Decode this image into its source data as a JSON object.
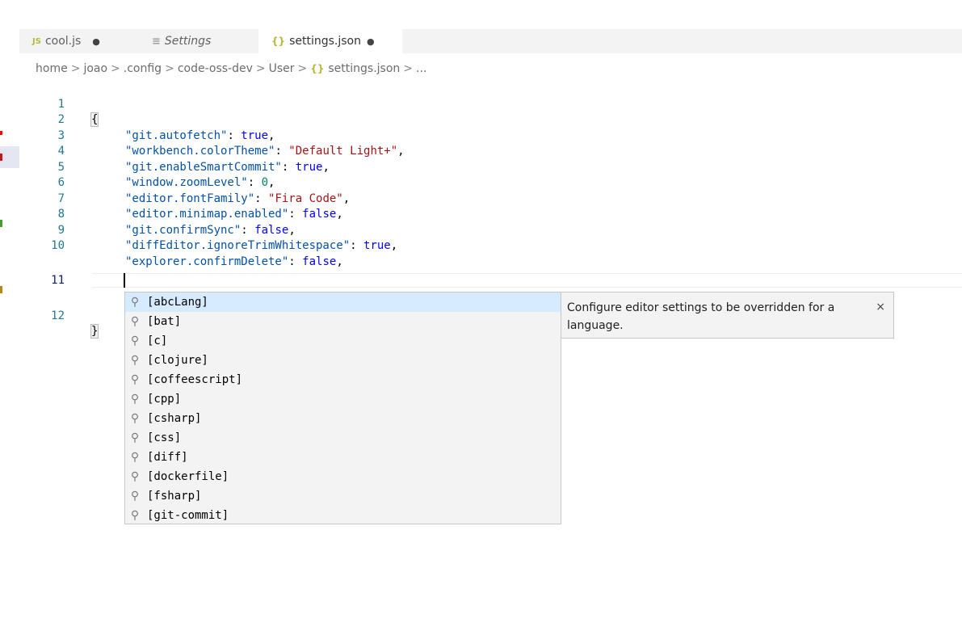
{
  "colors": {
    "left_marks": [
      "#e51400",
      "#c41919",
      "#4b9a2e",
      "#b5861c"
    ],
    "selection_bg": "#d6ebff",
    "string": "#a31515",
    "keyword": "#0000ff",
    "number": "#098658",
    "property": "#0451a5",
    "line_number": "#237893"
  },
  "tabs": [
    {
      "icon": "JS",
      "label": "cool.js",
      "dirty": "●",
      "active": false
    },
    {
      "icon": "≡",
      "label": "Settings",
      "dirty": "",
      "active": false,
      "italic": true
    },
    {
      "icon": "{}",
      "label": "settings.json",
      "dirty": "●",
      "active": true
    }
  ],
  "breadcrumb": {
    "parts": [
      "home",
      "joao",
      ".config",
      "code-oss-dev",
      "User"
    ],
    "file_icon": "{}",
    "file": "settings.json",
    "tail": "...",
    "separator": ">"
  },
  "editor": {
    "line_numbers": [
      "1",
      "2",
      "3",
      "4",
      "5",
      "6",
      "7",
      "8",
      "9",
      "10",
      "11",
      "12"
    ],
    "current_line": "11",
    "open_brace": "{",
    "close_brace": "}",
    "settings": [
      {
        "key": "\"git.autofetch\"",
        "value": "true",
        "type": "kw"
      },
      {
        "key": "\"workbench.colorTheme\"",
        "value": "\"Default Light+\"",
        "type": "str"
      },
      {
        "key": "\"git.enableSmartCommit\"",
        "value": "true",
        "type": "kw"
      },
      {
        "key": "\"window.zoomLevel\"",
        "value": "0",
        "type": "num"
      },
      {
        "key": "\"editor.fontFamily\"",
        "value": "\"Fira Code\"",
        "type": "str"
      },
      {
        "key": "\"editor.minimap.enabled\"",
        "value": "false",
        "type": "kw"
      },
      {
        "key": "\"git.confirmSync\"",
        "value": "false",
        "type": "kw"
      },
      {
        "key": "\"diffEditor.ignoreTrimWhitespace\"",
        "value": "true",
        "type": "kw"
      },
      {
        "key": "\"explorer.confirmDelete\"",
        "value": "false",
        "type": "kw"
      }
    ]
  },
  "suggest": {
    "items": [
      "[abcLang]",
      "[bat]",
      "[c]",
      "[clojure]",
      "[coffeescript]",
      "[cpp]",
      "[csharp]",
      "[css]",
      "[diff]",
      "[dockerfile]",
      "[fsharp]",
      "[git-commit]"
    ],
    "selected_index": 0,
    "details": "Configure editor settings to be overridden for a language.",
    "close_glyph": "×"
  }
}
